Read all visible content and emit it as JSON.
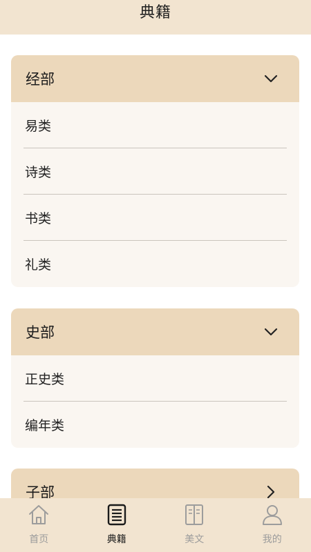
{
  "header": {
    "title": "典籍"
  },
  "sections": [
    {
      "title": "经部",
      "expanded": true,
      "items": [
        "易类",
        "诗类",
        "书类",
        "礼类"
      ]
    },
    {
      "title": "史部",
      "expanded": true,
      "items": [
        "正史类",
        "编年类"
      ]
    },
    {
      "title": "子部",
      "expanded": false,
      "items": []
    }
  ],
  "tabbar": {
    "tabs": [
      {
        "label": "首页",
        "icon": "home-icon",
        "active": false
      },
      {
        "label": "典籍",
        "icon": "book-list-icon",
        "active": true
      },
      {
        "label": "美文",
        "icon": "open-book-icon",
        "active": false
      },
      {
        "label": "我的",
        "icon": "user-icon",
        "active": false
      }
    ]
  },
  "colors": {
    "header_bg": "#f2e4d0",
    "section_header_bg": "#ecd8bb",
    "section_body_bg": "#faf6f1",
    "active_tab": "#1a1a1a",
    "inactive_tab": "#9c9c9c"
  }
}
